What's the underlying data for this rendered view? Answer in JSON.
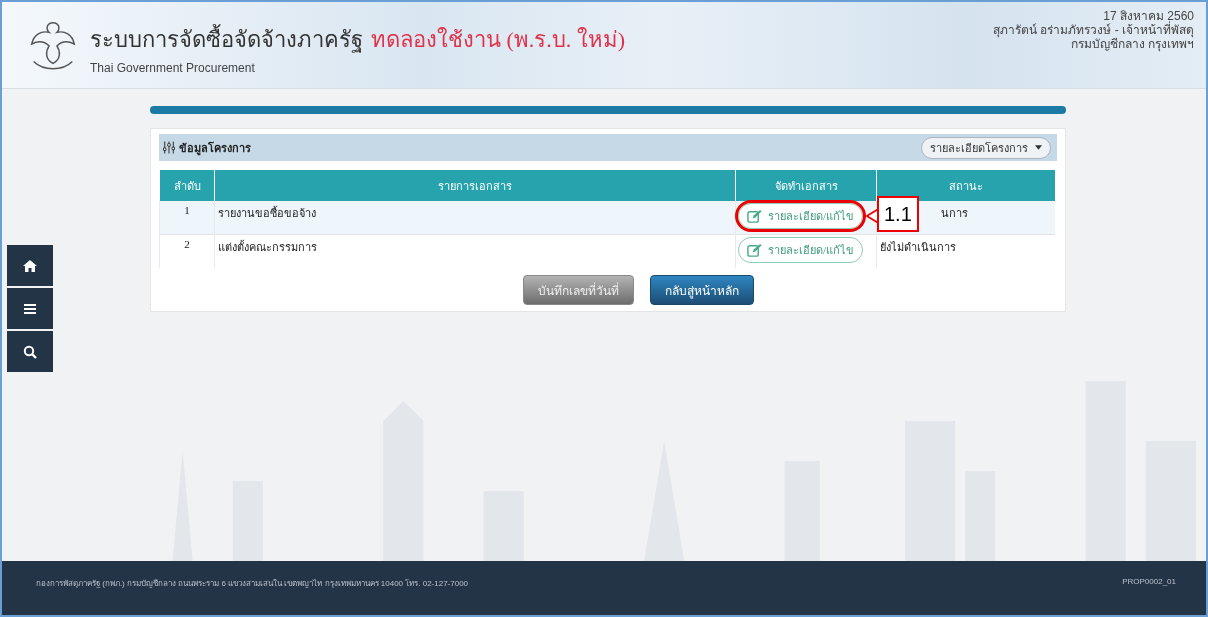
{
  "header": {
    "title": "ระบบการจัดซื้อจัดจ้างภาครัฐ",
    "title_note": "ทดลองใช้งาน (พ.ร.บ. ใหม่)",
    "subtitle": "Thai Government Procurement",
    "date": "17 สิงหาคม 2560",
    "user": "สุภารัตน์ อร่ามภัทรวงษ์ - เจ้าหน้าที่พัสดุ",
    "org": "กรมบัญชีกลาง กรุงเทพฯ"
  },
  "progress": {
    "level": 1
  },
  "sidebar": {
    "items": [
      {
        "kind": "home"
      },
      {
        "kind": "menu"
      },
      {
        "kind": "search"
      }
    ]
  },
  "panel": {
    "title": "ข้อมูลโครงการ",
    "dropdown": "รายละเอียดโครงการ",
    "table": {
      "columns": [
        "ลำดับ",
        "รายการเอกสาร",
        "จัดทำเอกสาร",
        "สถานะ"
      ],
      "rows": [
        {
          "no": "1",
          "document": "รายงานขอซื้อขอจ้าง",
          "action": "รายละเอียด/แก้ไข",
          "highlighted": true,
          "status": "นการ"
        },
        {
          "no": "2",
          "document": "แต่งตั้งคณะกรรมการ",
          "action": "รายละเอียด/แก้ไข",
          "highlighted": false,
          "status": "ยังไม่ดำเนินการ"
        }
      ]
    },
    "buttons": [
      {
        "label": "บันทึกเลขที่วันที่",
        "disabled": true
      },
      {
        "label": "กลับสู่หน้าหลัก",
        "disabled": false
      }
    ]
  },
  "annotation": {
    "label": "1.1"
  },
  "footer": {
    "address": "กองการพัสดุภาครัฐ (กพภ.) กรมบัญชีกลาง ถนนพระราม 6 แขวงสามเสนใน เขตพญาไท กรุงเทพมหานคร 10400 โทร. 02-127-7000",
    "code": "PROP0002_01"
  }
}
